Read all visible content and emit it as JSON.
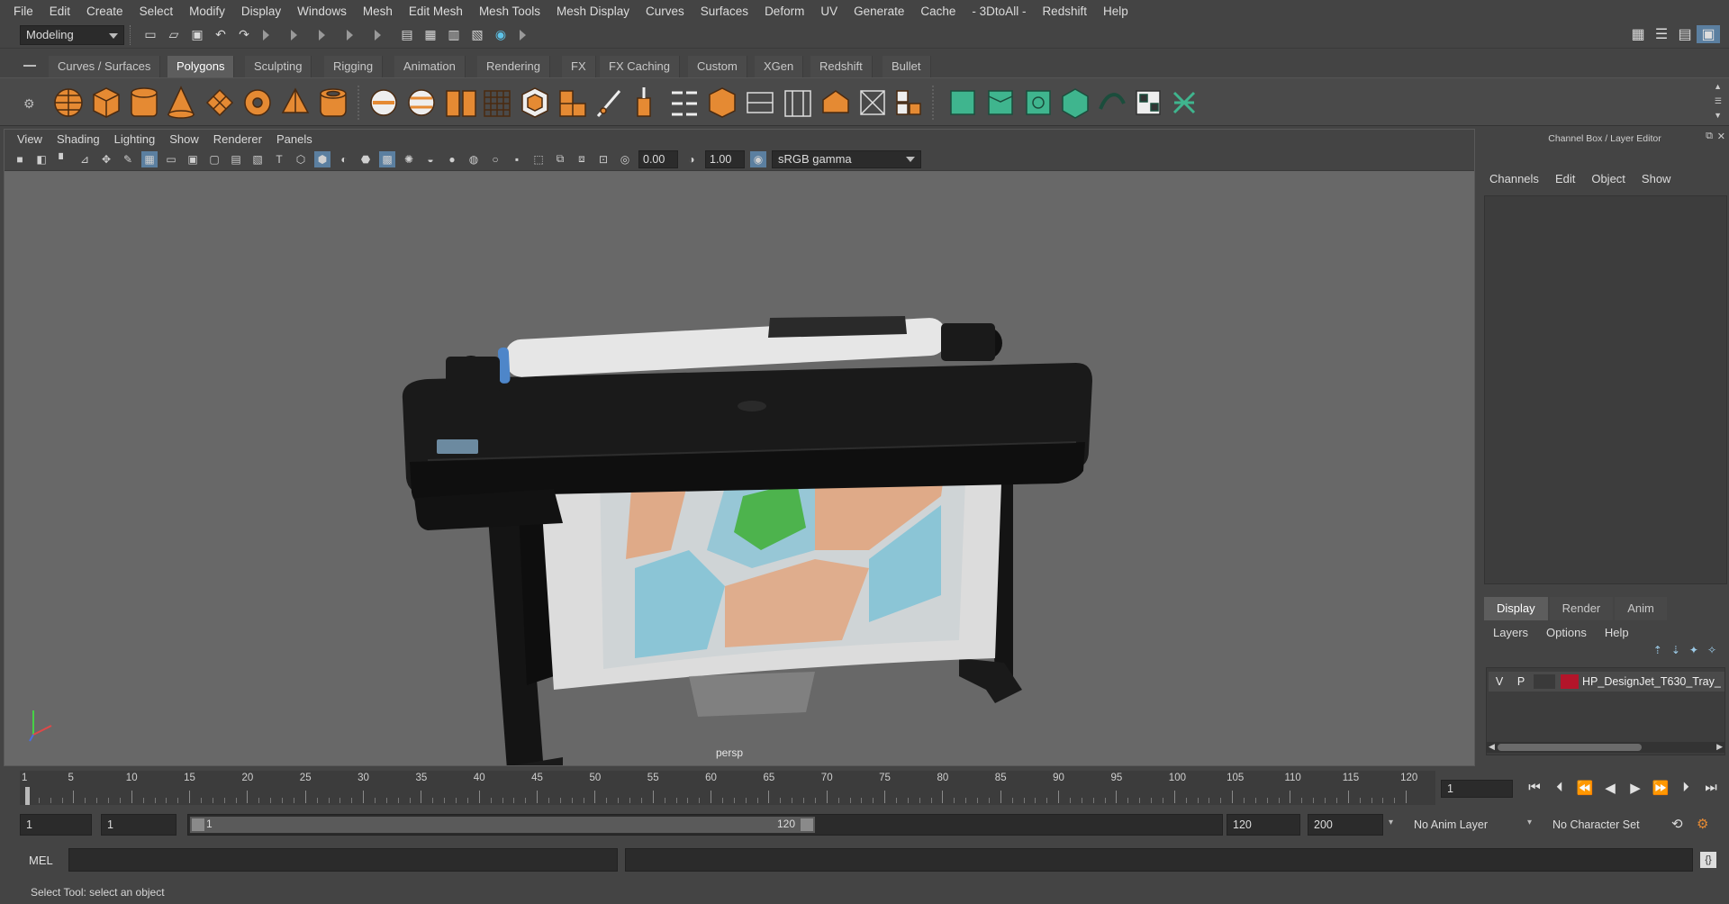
{
  "menubar": {
    "items": [
      "File",
      "Edit",
      "Create",
      "Select",
      "Modify",
      "Display",
      "Windows",
      "Mesh",
      "Edit Mesh",
      "Mesh Tools",
      "Mesh Display",
      "Curves",
      "Surfaces",
      "Deform",
      "UV",
      "Generate",
      "Cache",
      "- 3DtoAll -",
      "Redshift",
      "Help"
    ]
  },
  "statusline": {
    "workspace": "Modeling"
  },
  "shelf": {
    "tabs": [
      "Curves / Surfaces",
      "Polygons",
      "Sculpting",
      "Rigging",
      "Animation",
      "Rendering",
      "FX",
      "FX Caching",
      "Custom",
      "XGen",
      "Redshift",
      "Bullet"
    ],
    "active_tab": "Polygons"
  },
  "viewport": {
    "menu": [
      "View",
      "Shading",
      "Lighting",
      "Show",
      "Renderer",
      "Panels"
    ],
    "exposure": "0.00",
    "gamma": "1.00",
    "color_space": "sRGB gamma",
    "camera_label": "persp"
  },
  "channel_box": {
    "title": "Channel Box / Layer Editor",
    "menu": [
      "Channels",
      "Edit",
      "Object",
      "Show"
    ]
  },
  "layer_editor": {
    "tabs": [
      "Display",
      "Render",
      "Anim"
    ],
    "active_tab": "Display",
    "menu": [
      "Layers",
      "Options",
      "Help"
    ],
    "layers": [
      {
        "visible": "V",
        "playback": "P",
        "name": "HP_DesignJet_T630_Tray_",
        "color": "#b3152a"
      }
    ]
  },
  "time_slider": {
    "tick_labels": [
      "1",
      "5",
      "10",
      "15",
      "20",
      "25",
      "30",
      "35",
      "40",
      "45",
      "50",
      "55",
      "60",
      "65",
      "70",
      "75",
      "80",
      "85",
      "90",
      "95",
      "100",
      "105",
      "110",
      "115",
      "120"
    ],
    "current_frame": "1"
  },
  "range_slider": {
    "start_time": "1",
    "playback_start": "1",
    "range_start_label": "1",
    "range_end_label": "120",
    "playback_end": "120",
    "end_time": "200",
    "anim_layer": "No Anim Layer",
    "character_set": "No Character Set"
  },
  "command_line": {
    "label": "MEL"
  },
  "help_line": {
    "text": "Select Tool: select an object"
  }
}
